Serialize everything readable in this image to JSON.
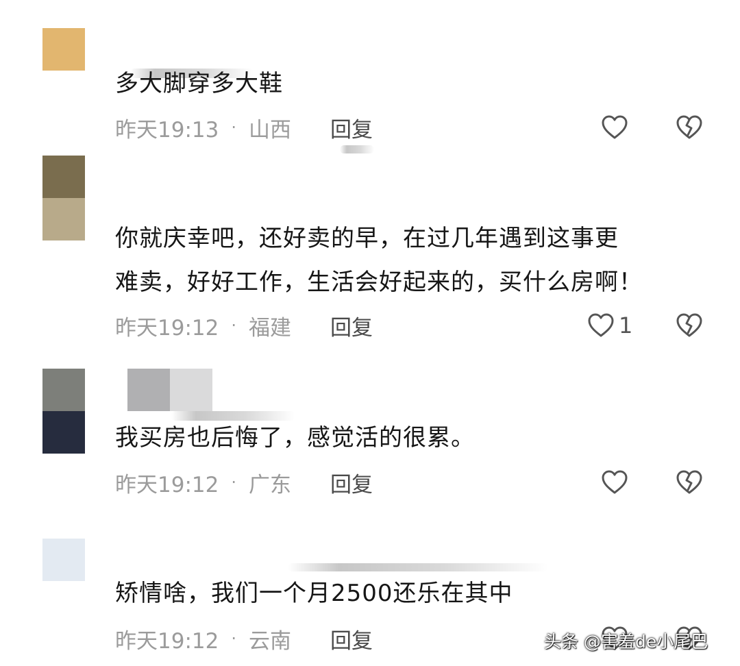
{
  "comments": [
    {
      "text": "多大脚穿多大鞋",
      "time": "昨天19:13",
      "location": "山西",
      "reply_label": "回复",
      "like_count": "",
      "avatar_colors": [
        "#e2b66f"
      ],
      "icons": {
        "like": "heart-outline-icon",
        "dislike": "broken-heart-icon"
      }
    },
    {
      "text_lines": [
        "你就庆幸吧，还好卖的早，在过几年遇到这事更",
        "难卖，好好工作，生活会好起来的，买什么房啊！"
      ],
      "time": "昨天19:12",
      "location": "福建",
      "reply_label": "回复",
      "like_count": "1",
      "avatar_colors": [
        "#7a6d4e",
        "#b8aa8a"
      ],
      "icons": {
        "like": "heart-outline-icon",
        "dislike": "broken-heart-icon"
      }
    },
    {
      "text": "我买房也后悔了，感觉活的很累。",
      "time": "昨天19:12",
      "location": "广东",
      "reply_label": "回复",
      "like_count": "",
      "avatar_colors": [
        "#7d7f7a",
        "#262c3e"
      ],
      "username_blur_colors": [
        "#b0b0b2",
        "#dadadb"
      ],
      "icons": {
        "like": "heart-outline-icon",
        "dislike": "broken-heart-icon"
      }
    },
    {
      "text": "矫情啥，我们一个月2500还乐在其中",
      "time": "昨天19:12",
      "location": "云南",
      "reply_label": "回复",
      "like_count": "",
      "avatar_colors": [
        "#e3eaf2"
      ],
      "icons": {
        "like": "heart-outline-icon",
        "dislike": "broken-heart-icon"
      }
    }
  ],
  "meta_separator": "·",
  "watermark": "头条 @害羞de小尾巴",
  "colors": {
    "text": "#161616",
    "meta": "#9b9b9b",
    "reply": "#4a4a4a",
    "icon": "#555555"
  }
}
